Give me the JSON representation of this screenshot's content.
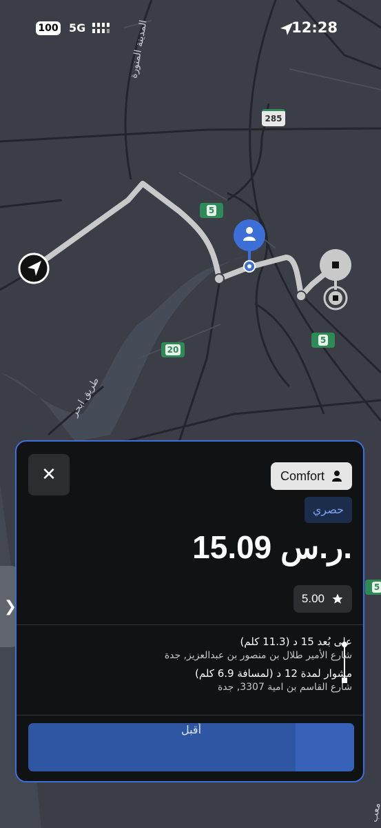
{
  "status_bar": {
    "battery": "100",
    "network": "5G",
    "time": "12:28"
  },
  "map": {
    "labels": {
      "madinah_road": "المدينة المنورة",
      "abhur_road": "طريق ابحر",
      "edge_label": "معب"
    },
    "road_badges": {
      "r285": "285",
      "r5_top": "5",
      "r5_mid": "5",
      "r20": "20",
      "r5_right": "5"
    },
    "colors": {
      "route": "#c9c9c9",
      "accent": "#3d6fd8",
      "highway_badge": "#2e8b57"
    }
  },
  "side_tab": {
    "glyph": "❯"
  },
  "card": {
    "close_glyph": "✕",
    "vehicle_type": "Comfort",
    "tag": "حصري",
    "price": "15.09 ر.س.",
    "rating": "5.00",
    "pickup": {
      "eta": "على بُعد 15 د (11.3 كلم)",
      "address": "شارع الأمير طلال بن منصور بن عبدالعزيز, جدة"
    },
    "dropoff": {
      "eta": "مشوار لمدة 12 د (لمسافة 6.9 كلم)",
      "address": "شارع القاسم بن امية 3307, جدة"
    },
    "accept_label": "أقبل",
    "accept_progress": 0.18
  }
}
